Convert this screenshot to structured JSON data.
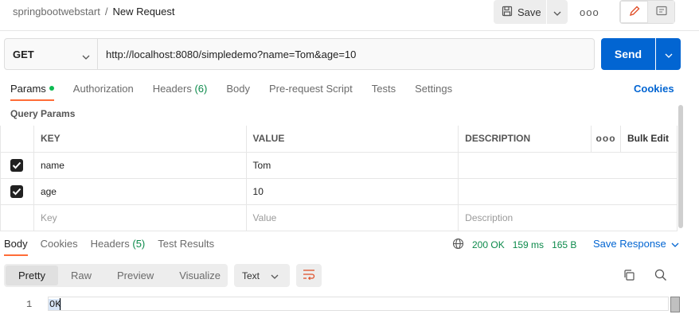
{
  "breadcrumb": {
    "parent": "springbootwebstart",
    "separator": "/",
    "current": "New Request"
  },
  "toolbar": {
    "save_label": "Save",
    "more_label": "ooo"
  },
  "request": {
    "method": "GET",
    "url": "http://localhost:8080/simpledemo?name=Tom&age=10",
    "send_label": "Send"
  },
  "request_tabs": [
    {
      "label": "Params",
      "count": ""
    },
    {
      "label": "Authorization",
      "count": ""
    },
    {
      "label": "Headers",
      "count": "(6)"
    },
    {
      "label": "Body",
      "count": ""
    },
    {
      "label": "Pre-request Script",
      "count": ""
    },
    {
      "label": "Tests",
      "count": ""
    },
    {
      "label": "Settings",
      "count": ""
    }
  ],
  "cookies_link": "Cookies",
  "query_params": {
    "title": "Query Params",
    "headers": {
      "key": "KEY",
      "value": "VALUE",
      "description": "DESCRIPTION",
      "more": "ooo",
      "bulk_edit": "Bulk Edit"
    },
    "rows": [
      {
        "key": "name",
        "value": "Tom",
        "description": "",
        "checked": true
      },
      {
        "key": "age",
        "value": "10",
        "description": "",
        "checked": true
      }
    ],
    "placeholders": {
      "key": "Key",
      "value": "Value",
      "description": "Description"
    }
  },
  "response_tabs": [
    {
      "label": "Body",
      "count": ""
    },
    {
      "label": "Cookies",
      "count": ""
    },
    {
      "label": "Headers",
      "count": "(5)"
    },
    {
      "label": "Test Results",
      "count": ""
    }
  ],
  "response_meta": {
    "status": "200 OK",
    "time": "159 ms",
    "size": "165 B",
    "save_response": "Save Response"
  },
  "view_tabs": [
    "Pretty",
    "Raw",
    "Preview",
    "Visualize"
  ],
  "format": "Text",
  "body": {
    "line_number": "1",
    "content": "OK"
  },
  "colors": {
    "accent": "#ff6c37",
    "primary": "#0265d2",
    "success": "#0c8a4b"
  }
}
